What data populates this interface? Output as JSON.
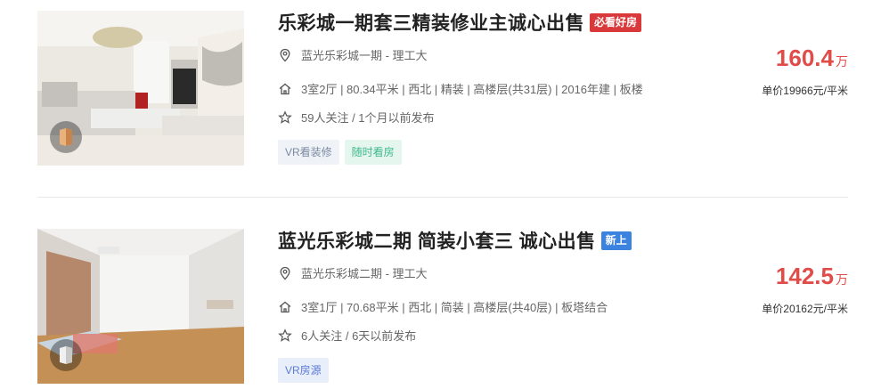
{
  "listings": [
    {
      "title": "乐彩城一期套三精装修业主诚心出售",
      "tag": {
        "label": "必看好房",
        "color": "#d9393b"
      },
      "location": "蓝光乐彩城一期 - 理工大",
      "details": "3室2厅 | 80.34平米 | 西北 | 精装 | 高楼层(共31层) | 2016年建 | 板楼",
      "follow": "59人关注 / 1个月以前发布",
      "chips": [
        {
          "label": "VR看装修",
          "bg": "#eff3f8",
          "color": "#7b8aa0"
        },
        {
          "label": "随时看房",
          "bg": "#e5f6ee",
          "color": "#3fb98a"
        }
      ],
      "price_total": "160.4",
      "price_unit": "万",
      "unit_price": "单价19966元/平米"
    },
    {
      "title": "蓝光乐彩城二期 简装小套三 诚心出售",
      "tag": {
        "label": "新上",
        "color": "#3c83e0"
      },
      "location": "蓝光乐彩城二期 - 理工大",
      "details": "3室1厅 | 70.68平米 | 西北 | 简装 | 高楼层(共40层) | 板塔结合",
      "follow": "6人关注 / 6天以前发布",
      "chips": [
        {
          "label": "VR房源",
          "bg": "#e9eefb",
          "color": "#5a7bd6"
        }
      ],
      "price_total": "142.5",
      "price_unit": "万",
      "unit_price": "单价20162元/平米"
    }
  ]
}
